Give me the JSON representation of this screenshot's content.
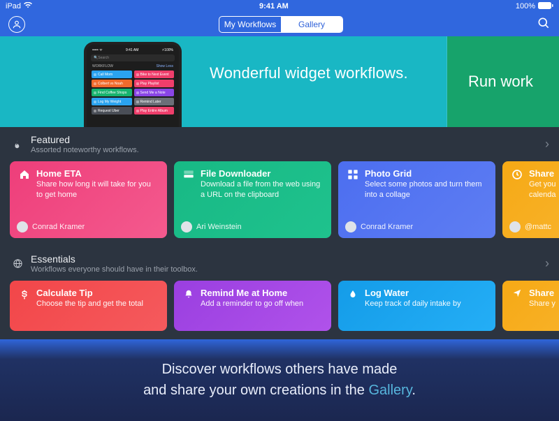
{
  "status": {
    "device": "iPad",
    "time": "9:41 AM",
    "battery": "100%"
  },
  "nav": {
    "tabs": {
      "left": "My Workflows",
      "right": "Gallery"
    }
  },
  "hero": {
    "title": "Wonderful widget workflows.",
    "next_title": "Run work",
    "phone": {
      "search": "Search",
      "header_left": "WORKFLOW",
      "header_right": "Show Less",
      "pills": [
        [
          "Call Mom",
          "Bike to Next Event"
        ],
        [
          "Colbert vs Noah",
          "Play Playlist"
        ],
        [
          "Find Coffee Shops",
          "Send Me a Note"
        ],
        [
          "Log My Weight",
          "Remind Later"
        ],
        [
          "Request Uber",
          "Play Entire Album"
        ]
      ]
    }
  },
  "sections": [
    {
      "icon": "flame-icon",
      "title": "Featured",
      "subtitle": "Assorted noteworthy workflows.",
      "cards": [
        {
          "grad": "grad-pink",
          "icon": "home-icon",
          "title": "Home ETA",
          "desc": "Share how long it will take for you to get home",
          "author": "Conrad Kramer"
        },
        {
          "grad": "grad-green",
          "icon": "download-icon",
          "title": "File Downloader",
          "desc": "Download a file from the web using a URL on the clipboard",
          "author": "Ari Weinstein"
        },
        {
          "grad": "grad-blue",
          "icon": "grid-icon",
          "title": "Photo Grid",
          "desc": "Select some photos and turn them into a collage",
          "author": "Conrad Kramer"
        },
        {
          "grad": "grad-yellow",
          "icon": "clock-icon",
          "title": "Share",
          "desc": "Get you\ncalenda",
          "author": "@mattc"
        }
      ]
    },
    {
      "icon": "globe-icon",
      "title": "Essentials",
      "subtitle": "Workflows everyone should have in their toolbox.",
      "cards": [
        {
          "grad": "grad-red",
          "icon": "dollar-icon",
          "title": "Calculate Tip",
          "desc": "Choose the tip and get the total"
        },
        {
          "grad": "grad-purple",
          "icon": "bell-icon",
          "title": "Remind Me at Home",
          "desc": "Add a reminder to go off when"
        },
        {
          "grad": "grad-cyan",
          "icon": "drop-icon",
          "title": "Log Water",
          "desc": "Keep track of daily intake by"
        },
        {
          "grad": "grad-yellow",
          "icon": "send-icon",
          "title": "Share",
          "desc": "Share y"
        }
      ]
    }
  ],
  "promo": {
    "line1": "Discover workflows others have made",
    "line2_a": "and share your own creations in the ",
    "line2_b": "Gallery",
    "line2_c": "."
  }
}
